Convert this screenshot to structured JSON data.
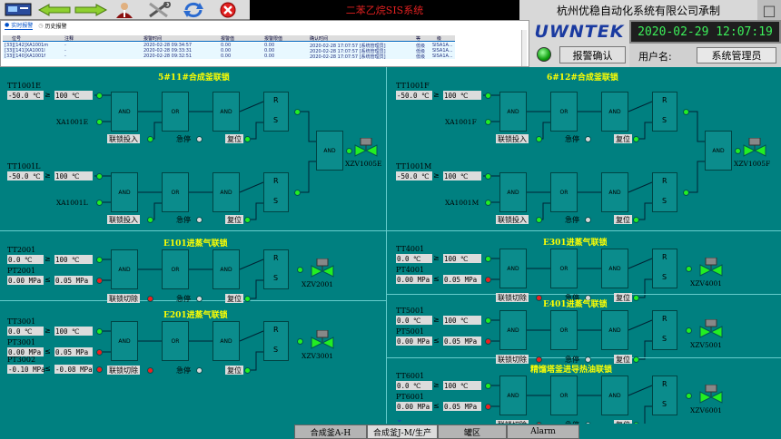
{
  "window": {
    "title": "二苯乙烷SIS系统",
    "company": "杭州优稳自动化系统有限公司承制",
    "close": "□"
  },
  "toolbar": {
    "buttons": [
      "monitor-icon",
      "back-arrow-icon",
      "forward-arrow-icon",
      "operator-icon",
      "tools-icon",
      "refresh-icon",
      "close-circle-icon"
    ]
  },
  "alarm": {
    "tabs": [
      {
        "label": "实时报警",
        "active": true
      },
      {
        "label": "历史报警",
        "active": false
      }
    ],
    "headers": [
      "位号",
      "注释",
      "报警时间",
      "报警值",
      "报警限值",
      "确认时间",
      "等",
      "级"
    ],
    "rows": [
      [
        "[33][142]XA1001m",
        "-",
        "2020-02-28 09:34:57",
        "0.00",
        "0.00",
        "2020-02-28 17:07:57 [系统管理员]",
        "低级",
        "SISA1A..."
      ],
      [
        "[33][141]XA1001l",
        "-",
        "2020-02-28 09:33:31",
        "0.00",
        "0.00",
        "2020-02-28 17:07:57 [系统管理员]",
        "低级",
        "SISA1A..."
      ],
      [
        "[33][140]XA1001f",
        "-",
        "2020-02-28 09:32:51",
        "0.00",
        "0.00",
        "2020-02-28 17:07:57 [系统管理员]",
        "低级",
        "SISA1A..."
      ]
    ]
  },
  "header": {
    "logo": "UWNTEK",
    "clock": "2020-02-29 12:07:19",
    "ack_label": "报警确认",
    "user_label": "用户名:",
    "user_name": "系统管理员"
  },
  "panels": {
    "p5": {
      "title": "5#11#合成釜联锁",
      "ttF": "TT1001E",
      "ttFv": "-50.0 ℃",
      "limF": "100 ℃",
      "xaF": "XA1001E",
      "ttL": "TT1001L",
      "ttLv": "-50.0 ℃",
      "limL": "100 ℃",
      "xaL": "XA1001L",
      "valve": "XZV1005E"
    },
    "p6": {
      "title": "6#12#合成釜联锁",
      "ttF": "TT1001F",
      "ttFv": "-50.0 ℃",
      "limF": "100 ℃",
      "xaF": "XA1001F",
      "ttL": "TT1001M",
      "ttLv": "-50.0 ℃",
      "limL": "100 ℃",
      "xaL": "XA1001M",
      "valve": "XZV1005F"
    },
    "e101": {
      "title": "E101进蒸气联锁",
      "tt": "TT2001",
      "ttv": "0.0 ℃",
      "ttlim": "100 ℃",
      "pt": "PT2001",
      "ptv": "0.00 MPa",
      "ptlim": "0.05 MPa",
      "valve": "XZV2001"
    },
    "e201": {
      "title": "E201进蒸气联锁",
      "tt": "TT3001",
      "ttv": "0.0 ℃",
      "ttlim": "100 ℃",
      "pt": "PT3001",
      "ptv": "0.00 MPa",
      "ptlim": "0.05 MPa",
      "pt2": "PT3002",
      "pt2v": "-0.10 MPa",
      "pt2lim": "-0.08 MPa",
      "valve": "XZV3001"
    },
    "e301": {
      "title": "E301进蒸气联锁",
      "tt": "TT4001",
      "ttv": "0.0 ℃",
      "ttlim": "100 ℃",
      "pt": "PT4001",
      "ptv": "0.00 MPa",
      "ptlim": "0.05 MPa",
      "valve": "XZV4001"
    },
    "e401": {
      "title": "E401进蒸气联锁",
      "tt": "TT5001",
      "ttv": "0.0 ℃",
      "ttlim": "100 ℃",
      "pt": "PT5001",
      "ptv": "0.00 MPa",
      "ptlim": "0.05 MPa",
      "valve": "XZV5001"
    },
    "e501": {
      "title": "精馏塔釜进导热油联锁",
      "tt": "TT6001",
      "ttv": "0.0 ℃",
      "ttlim": "100 ℃",
      "pt": "PT6001",
      "ptv": "0.00 MPa",
      "ptlim": "0.05 MPa",
      "valve": "XZV6001"
    }
  },
  "labels": {
    "and": "AND",
    "or": "OR",
    "r": "R",
    "s": "S",
    "ge": "≥",
    "le": "≤",
    "bypass_on": "联锁投入",
    "bypass_off": "联锁切除",
    "estop": "急停",
    "reset": "复位"
  },
  "nav": [
    {
      "label": "合成釜A-H",
      "active": false
    },
    {
      "label": "合成釜J-M/生产",
      "active": true
    },
    {
      "label": "罐区",
      "active": false
    },
    {
      "label": "Alarm",
      "active": false
    }
  ],
  "colors": {
    "bg": "#008080",
    "title": "#ffff00",
    "on": "#22ee22",
    "alarm": "#ee2020"
  }
}
